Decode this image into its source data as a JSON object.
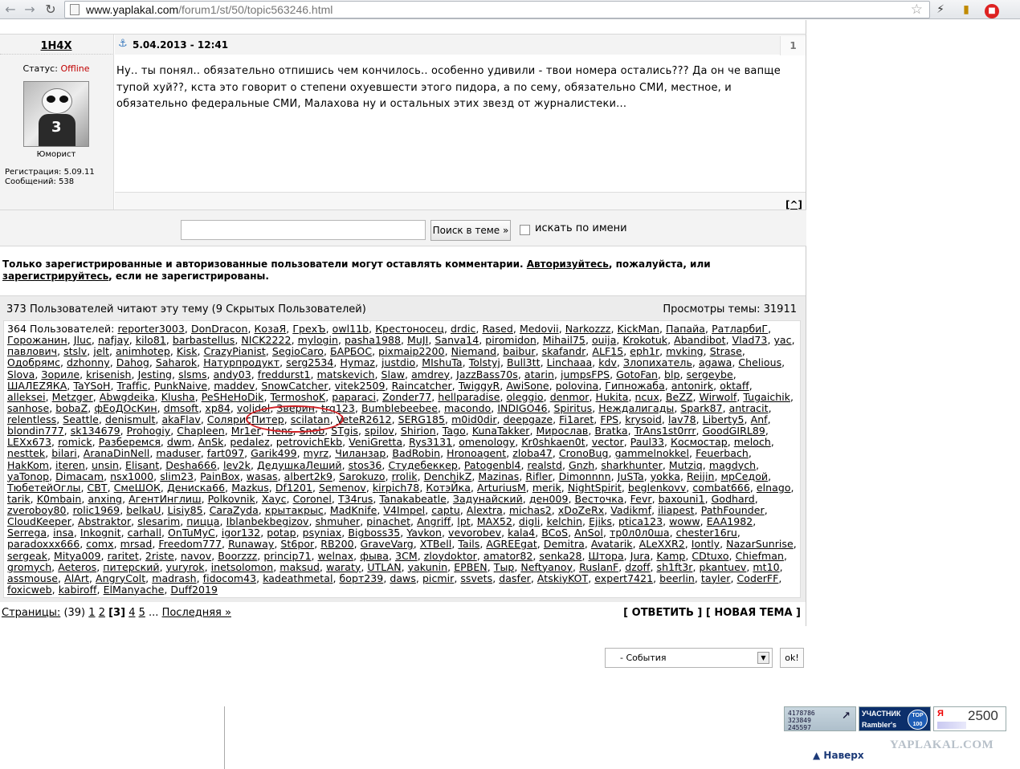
{
  "browser": {
    "url_host": "www.yaplakal.com",
    "url_path": "/forum1/st/50/topic563246.html"
  },
  "post": {
    "author": "1H4X",
    "status_label": "Статус:",
    "status_value": "Offline",
    "rank": "Юморист",
    "registration": "Регистрация: 5.09.11",
    "messages": "Сообщений: 538",
    "date": "5.04.2013 - 12:41",
    "number": "1",
    "text": "Ну.. ты понял.. обязательно отпишись чем кончилось.. особенно удивили - твои номера остались??? Да он че вапще тупой хуй??, кста это говорит о степени охуевшести этого пидора, а по сему, обязательно СМИ, местное, и обязательно федеральные СМИ, Малахова ну и остальных этих звезд от журналистеки...",
    "to_top": "[^]"
  },
  "search": {
    "button": "Поиск в теме »",
    "by_name": "искать по имени"
  },
  "notice": {
    "part1": "Только зарегистрированные и авторизованные пользователи могут оставлять комментарии. ",
    "login": "Авторизуйтесь",
    "part2": ", пожалуйста, или ",
    "register": "зарегистрируйтесь",
    "part3": ", если не зарегистрированы."
  },
  "online": {
    "header": "373 Пользователей читают эту тему (9 Скрытых Пользователей)",
    "views": "Просмотры темы: 31911",
    "prefix": "364 Пользователей: ",
    "users": [
      "reporter3003",
      "DonDracon",
      "КозаЯ",
      "ГрехЪ",
      "owl11b",
      "Крестоносец",
      "drdic",
      "Rased",
      "Medovii",
      "Narkozzz",
      "KickMan",
      "Папайа",
      "РатларбиГ",
      "Горожанин",
      "Jluc",
      "nafjay",
      "kilo81",
      "barbastellus",
      "NICK2222",
      "mylogin",
      "pasha1988",
      "MuJI",
      "Sanva14",
      "piromidon",
      "Mihail75",
      "ouija",
      "Krokotuk",
      "Abandibot",
      "Vlad73",
      "yac",
      "павлович",
      "stslv",
      "jelt",
      "animhotep",
      "Kisk",
      "CrazyPianist",
      "SegioCaro",
      "БАРБОС",
      "pixmaip2200",
      "Niemand",
      "baibur",
      "skafandr",
      "ALF15",
      "eph1r",
      "mvking",
      "Strase",
      "Одобрямс",
      "dzhonny",
      "Dahog",
      "Saharok",
      "Натурпродукт",
      "serg2534",
      "Hymaz",
      "justdio",
      "MIshuTa",
      "Tolstyj",
      "Bull3tt",
      "Linchaaa",
      "kdv",
      "Злопихатель",
      "agawa",
      "Chelious",
      "Slova",
      "Зориле",
      "krisenish",
      "Jesting",
      "slsms",
      "andy03",
      "freddurst1",
      "matskevich",
      "Slaw",
      "amdrey",
      "JazzBass70s",
      "atarin",
      "jumpsFPS",
      "GotoFan",
      "blp",
      "sergeybe",
      "ШАЛЕZЯКА",
      "TaYSoH",
      "Traffic",
      "PunkNaive",
      "maddev",
      "SnowCatcher",
      "vitek2509",
      "Raincatcher",
      "TwiggyR",
      "AwiSone",
      "polovina",
      "Гипножаба",
      "antonirk",
      "oktaff",
      "alleksei",
      "Metzger",
      "Abwgdeika",
      "Klusha",
      "PeSHeHoDik",
      "TermoshoK",
      "paparaci",
      "Zonder77",
      "hellparadise",
      "oleggio",
      "denmor",
      "Hukita",
      "ncux",
      "BeZZ",
      "Wirwolf",
      "Tugaichik",
      "sanhose",
      "bobaZ",
      "фЕоДОсКин",
      "dmsoft",
      "xp84",
      "volidol",
      "Зверин",
      "trq123",
      "Bumblebeebee",
      "macondo",
      "INDIGO46",
      "Spiritus",
      "Неждалигады",
      "Spark87",
      "antracit",
      "relentless",
      "Seattle",
      "denismult",
      "akaFlav",
      "СолярисПитер",
      "scilatan",
      "VeteR2612",
      "SERG185",
      "m0id0dir",
      "deepgaze",
      "Fi1aret",
      "FPS",
      "krysoid",
      "lav78",
      "Liberty5",
      "Anf",
      "blondin777",
      "sk134679",
      "Prohogiy",
      "Chapleen",
      "Mr1er",
      "Hens",
      "Snob",
      "STgis",
      "spilov",
      "Shirion",
      "Tago",
      "KunaTakker",
      "Мирослав",
      "Bratka",
      "TrAns1st0rrr",
      "GoodGIRL89",
      "LEXx673",
      "romick",
      "Разберемся",
      "dwm",
      "AnSk",
      "pedalez",
      "petrovichEkb",
      "VeniGretta",
      "Rys3131",
      "omenology",
      "Kr0shkaen0t",
      "vector",
      "Paul33",
      "Космостар",
      "meloch",
      "nesttek",
      "bilari",
      "AranaDinNell",
      "maduser",
      "fart097",
      "Garik499",
      "myrz",
      "Чиланзар",
      "BadRobin",
      "Hronoagent",
      "zloba47",
      "CronoBug",
      "gammelnokkel",
      "Feuerbach",
      "HakKom",
      "iteren",
      "unsin",
      "Elisant",
      "Desha666",
      "lev2k",
      "ДедушкаЛеший",
      "stos36",
      "Студебеккер",
      "Patogenbl4",
      "realstd",
      "Gnzh",
      "sharkhunter",
      "Mutziq",
      "magdych",
      "yaTonop",
      "Dimacam",
      "nsx1000",
      "slim23",
      "PainBox",
      "wasas",
      "albert2k9",
      "Sarokuzo",
      "rrolik",
      "DenchikZ",
      "Mazinas",
      "Rifler",
      "Dimonnnn",
      "JuSTa",
      "yokka",
      "Reijin",
      "мрСедой",
      "ТюбетейОглы",
      "СВТ",
      "СмеШОК",
      "Денискa66",
      "Mazkus",
      "Df1201",
      "Semenov",
      "kirpich78",
      "КотэЙка",
      "ArturiusM",
      "merik",
      "NightSpirit",
      "beglenkovv",
      "combat666",
      "elnago",
      "tarik",
      "K0mbain",
      "anxing",
      "АгентИнглиш",
      "Polkovnik",
      "Хаус",
      "Coronel",
      "T34rus",
      "Tanakabeatle",
      "Задунайский",
      "ден009",
      "Весточка",
      "Fevr",
      "baxouni1",
      "Godhard",
      "zveroboy80",
      "rolic1969",
      "belkaU",
      "Lisiy85",
      "CaraZyda",
      "крытакрыс",
      "MadKnife",
      "V4Impel",
      "captu",
      "Alextra",
      "michas2",
      "xDoZeRx",
      "Vadikmf",
      "iliapest",
      "PathFounder",
      "CloudKeeper",
      "Abstraktor",
      "slesarim",
      "пицца",
      "Iblanbekbegizov",
      "shmuher",
      "pinachet",
      "Angriff",
      "lpt",
      "MAX52",
      "digli",
      "kelchin",
      "Ejiks",
      "ptica123",
      "woww",
      "EAA1982",
      "Serrega",
      "insa",
      "Inkognit",
      "carhall",
      "OnTuMyC",
      "igor132",
      "potap",
      "psyniax",
      "Bigboss35",
      "Yavkon",
      "vevorobev",
      "kala4",
      "BCoS",
      "AnSol",
      "тр0л0л0ша",
      "chester16ru",
      "paradoxxx666",
      "comx",
      "mrsad",
      "Freedom777",
      "Runaway",
      "St6por",
      "RB200",
      "GraveVarg",
      "XTBell",
      "Tails",
      "AGREEgat",
      "Demitra",
      "Avatarik",
      "ALeXXR2",
      "Iontly",
      "NazarSunrise",
      "sergeak",
      "Mitya009",
      "raritet",
      "2riste",
      "navov",
      "Boorzzz",
      "princip71",
      "welnax",
      "фыва",
      "3CM",
      "zloydoktor",
      "amator82",
      "senka28",
      "Штора",
      "Jura",
      "Kamp",
      "CDtuxo",
      "Chiefman",
      "gromych",
      "Aeteros",
      "питерский",
      "yuryrok",
      "inetsolomon",
      "maksud",
      "waraty",
      "UTLAN",
      "yakunin",
      "EPBEN",
      "Тыр",
      "Neftyanoy",
      "RuslanF",
      "dzoff",
      "sh1ft3r",
      "pkantuev",
      "mt10",
      "assmouse",
      "AlArt",
      "AngryColt",
      "madrash",
      "fidocom43",
      "kadeathmetal",
      "борт239",
      "daws",
      "picmir",
      "ssvets",
      "dasfer",
      "AtskiyKOT",
      "expert7421",
      "beerlin",
      "tayler",
      "CoderFF",
      "foxicweb",
      "kabiroff",
      "ElManyache",
      "Duff2019"
    ]
  },
  "pager": {
    "label": "Страницы:",
    "count": " (39) ",
    "p1": "1",
    "p2": "2",
    "current": "[3]",
    "p4": "4",
    "p5": "5",
    "dots": " ... ",
    "last": "Последняя »"
  },
  "actions": {
    "reply": "[ ОТВЕТИТЬ ]",
    "new_topic": "[ НОВАЯ ТЕМА ]"
  },
  "footer": {
    "events_select": "- События",
    "ok": "ok!",
    "counter1": "4178786\n323849\n245597",
    "counter2_line1": "УЧАСТНИК",
    "counter2_line2": "Rambler's",
    "counter2_badge": "TOP\n100",
    "counter3_ya": "Я",
    "counter3_value": "2500",
    "to_top": "Наверх",
    "watermark": "YAPLAKAL.COM"
  },
  "colors": {
    "offline": "#c00000",
    "highlight_circle": "#d11f24",
    "panel": "#ececec"
  }
}
